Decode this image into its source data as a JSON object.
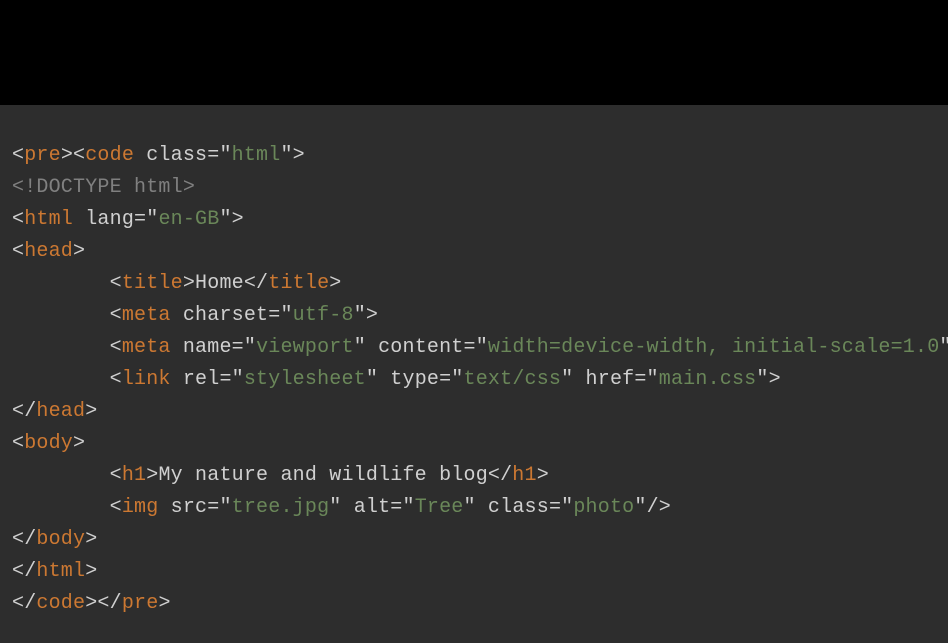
{
  "code": {
    "line1": {
      "lt1": "<",
      "tag1": "pre",
      "gt1": ">",
      "lt2": "<",
      "tag2": "code",
      "sp": " ",
      "attr": "class",
      "eq": "=\"",
      "val": "html",
      "q": "\"",
      "gt2": ">"
    },
    "line2": {
      "doctype": "<!DOCTYPE html>"
    },
    "line3": {
      "lt": "<",
      "tag": "html",
      "sp": " ",
      "attr": "lang",
      "eq": "=\"",
      "val": "en-GB",
      "q": "\"",
      "gt": ">"
    },
    "line4": {
      "lt": "<",
      "tag": "head",
      "gt": ">"
    },
    "line5": {
      "indent": "        ",
      "lt": "<",
      "tag": "title",
      "gt": ">",
      "text": "Home",
      "lt2": "</",
      "tag2": "title",
      "gt2": ">"
    },
    "line6": {
      "indent": "        ",
      "lt": "<",
      "tag": "meta",
      "sp": " ",
      "attr": "charset",
      "eq": "=\"",
      "val": "utf-8",
      "q": "\"",
      "gt": ">"
    },
    "line7": {
      "indent": "        ",
      "lt": "<",
      "tag": "meta",
      "sp": " ",
      "a1": "name",
      "e1": "=\"",
      "v1": "viewport",
      "q1": "\"",
      "sp2": " ",
      "a2": "content",
      "e2": "=\"",
      "v2": "width=device-width, initial-scale=1.0",
      "q2": "\"",
      "gt": ">"
    },
    "line8": {
      "indent": "        ",
      "lt": "<",
      "tag": "link",
      "sp": " ",
      "a1": "rel",
      "e1": "=\"",
      "v1": "stylesheet",
      "q1": "\"",
      "sp2": " ",
      "a2": "type",
      "e2": "=\"",
      "v2": "text/css",
      "q2": "\"",
      "sp3": " ",
      "a3": "href",
      "e3": "=\"",
      "v3": "main.css",
      "q3": "\"",
      "gt": ">"
    },
    "line9": {
      "lt": "</",
      "tag": "head",
      "gt": ">"
    },
    "line10": {
      "lt": "<",
      "tag": "body",
      "gt": ">"
    },
    "line11": {
      "indent": "        ",
      "lt": "<",
      "tag": "h1",
      "gt": ">",
      "text": "My nature and wildlife blog",
      "lt2": "</",
      "tag2": "h1",
      "gt2": ">"
    },
    "line12": {
      "indent": "        ",
      "lt": "<",
      "tag": "img",
      "sp": " ",
      "a1": "src",
      "e1": "=\"",
      "v1": "tree.jpg",
      "q1": "\"",
      "sp2": " ",
      "a2": "alt",
      "e2": "=\"",
      "v2": "Tree",
      "q2": "\"",
      "sp3": " ",
      "a3": "class",
      "e3": "=\"",
      "v3": "photo",
      "q3": "\"",
      "gt": "/>"
    },
    "line13": {
      "lt": "</",
      "tag": "body",
      "gt": ">"
    },
    "line14": {
      "lt": "</",
      "tag": "html",
      "gt": ">"
    },
    "line15": {
      "lt1": "</",
      "tag1": "code",
      "gt1": ">",
      "lt2": "</",
      "tag2": "pre",
      "gt2": ">"
    }
  }
}
